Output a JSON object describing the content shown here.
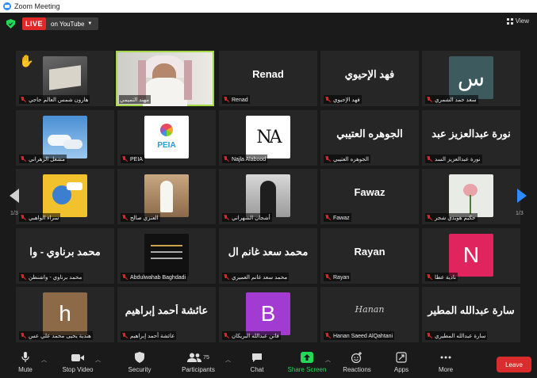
{
  "window": {
    "title": "Zoom Meeting"
  },
  "topbar": {
    "live_label": "LIVE",
    "live_destination": "on YouTube",
    "view_label": "View"
  },
  "pagination": {
    "left": "1/3",
    "right": "1/3"
  },
  "tiles": [
    {
      "big": "",
      "name": "هارون شمس العالم حاجي"
    },
    {
      "big": "",
      "name": "مهند التميمي"
    },
    {
      "big": "Renad",
      "name": "Renad"
    },
    {
      "big": "فهد الإحيوي",
      "name": "فهد الإحيوي"
    },
    {
      "big": "س",
      "name": "سعد حمد الشمري"
    },
    {
      "big": "",
      "name": "مشعل الزهراني"
    },
    {
      "big": "PEIA",
      "name": "PEIA"
    },
    {
      "big": "NA",
      "name": "Najla Alabood"
    },
    {
      "big": "الجوهره العتيبي",
      "name": "الجوهره العتيبي"
    },
    {
      "big": "نورة عبدالعزيز عبد",
      "name": "نورة عبدالعزيز السد"
    },
    {
      "big": "",
      "name": "سراء الواهبي"
    },
    {
      "big": "",
      "name": "العنزي صالح"
    },
    {
      "big": "",
      "name": "أشجان الشهراني"
    },
    {
      "big": "Fawaz",
      "name": "Fawaz"
    },
    {
      "big": "",
      "name": "حكيم هويدي شجر"
    },
    {
      "big": "محمد برناوي - وا",
      "name": "محمد برناوي - واشنطن"
    },
    {
      "big": "",
      "name": "Abdulwahab Baghdadi"
    },
    {
      "big": "محمد سعد غانم ال",
      "name": "محمد سعد غانم العميري"
    },
    {
      "big": "Rayan",
      "name": "Rayan"
    },
    {
      "big": "N",
      "name": "نادية عطا"
    },
    {
      "big": "h",
      "name": "هندية يحيى محمد علي عس"
    },
    {
      "big": "عائشة أحمد إبراهيم",
      "name": "عائشة أحمد إبراهيم"
    },
    {
      "big": "B",
      "name": "فاتن عبدالله البريكان"
    },
    {
      "big": "Hanan",
      "name": "Hanan Saeed AlQahtani"
    },
    {
      "big": "سارة عبدالله المطير",
      "name": "سارة عبدالله المطيري"
    }
  ],
  "toolbar": {
    "mute": "Mute",
    "stop_video": "Stop Video",
    "security": "Security",
    "participants": "Participants",
    "participants_count": "75",
    "chat": "Chat",
    "share_screen": "Share Screen",
    "reactions": "Reactions",
    "apps": "Apps",
    "more": "More",
    "leave": "Leave"
  },
  "colors": {
    "live": "#e02828",
    "active_speaker": "#a5d948",
    "share": "#23d959",
    "leave": "#d92d2d",
    "nav_next": "#2d8cff"
  }
}
